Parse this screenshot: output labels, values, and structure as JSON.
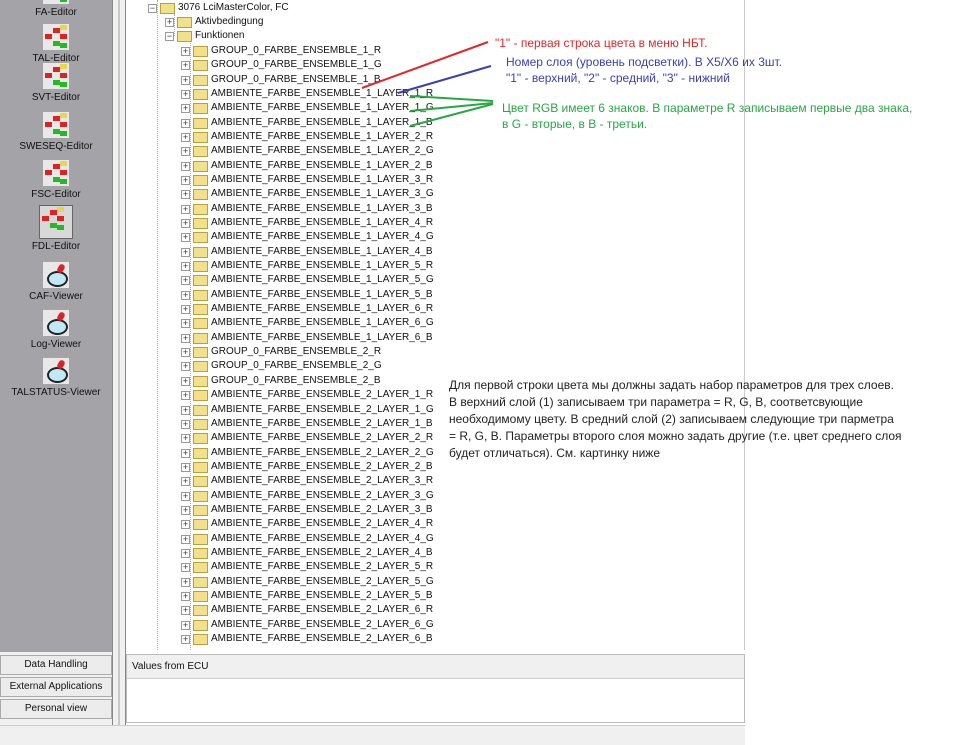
{
  "sidebar": {
    "tools": [
      "FA-Editor",
      "TAL-Editor",
      "SVT-Editor",
      "SWESEQ-Editor",
      "FSC-Editor",
      "FDL-Editor",
      "CAF-Viewer",
      "Log-Viewer",
      "TALSTATUS-Viewer"
    ],
    "selected": "FDL-Editor",
    "nav": [
      "Data Handling",
      "External Applications",
      "Personal view"
    ]
  },
  "tree": {
    "root": "3076 LciMasterColor, FC",
    "children": [
      "Aktivbedingung",
      "Funktionen"
    ],
    "functions": [
      "GROUP_0_FARBE_ENSEMBLE_1_R",
      "GROUP_0_FARBE_ENSEMBLE_1_G",
      "GROUP_0_FARBE_ENSEMBLE_1_B",
      "AMBIENTE_FARBE_ENSEMBLE_1_LAYER_1_R",
      "AMBIENTE_FARBE_ENSEMBLE_1_LAYER_1_G",
      "AMBIENTE_FARBE_ENSEMBLE_1_LAYER_1_B",
      "AMBIENTE_FARBE_ENSEMBLE_1_LAYER_2_R",
      "AMBIENTE_FARBE_ENSEMBLE_1_LAYER_2_G",
      "AMBIENTE_FARBE_ENSEMBLE_1_LAYER_2_B",
      "AMBIENTE_FARBE_ENSEMBLE_1_LAYER_3_R",
      "AMBIENTE_FARBE_ENSEMBLE_1_LAYER_3_G",
      "AMBIENTE_FARBE_ENSEMBLE_1_LAYER_3_B",
      "AMBIENTE_FARBE_ENSEMBLE_1_LAYER_4_R",
      "AMBIENTE_FARBE_ENSEMBLE_1_LAYER_4_G",
      "AMBIENTE_FARBE_ENSEMBLE_1_LAYER_4_B",
      "AMBIENTE_FARBE_ENSEMBLE_1_LAYER_5_R",
      "AMBIENTE_FARBE_ENSEMBLE_1_LAYER_5_G",
      "AMBIENTE_FARBE_ENSEMBLE_1_LAYER_5_B",
      "AMBIENTE_FARBE_ENSEMBLE_1_LAYER_6_R",
      "AMBIENTE_FARBE_ENSEMBLE_1_LAYER_6_G",
      "AMBIENTE_FARBE_ENSEMBLE_1_LAYER_6_B",
      "GROUP_0_FARBE_ENSEMBLE_2_R",
      "GROUP_0_FARBE_ENSEMBLE_2_G",
      "GROUP_0_FARBE_ENSEMBLE_2_B",
      "AMBIENTE_FARBE_ENSEMBLE_2_LAYER_1_R",
      "AMBIENTE_FARBE_ENSEMBLE_2_LAYER_1_G",
      "AMBIENTE_FARBE_ENSEMBLE_2_LAYER_1_B",
      "AMBIENTE_FARBE_ENSEMBLE_2_LAYER_2_R",
      "AMBIENTE_FARBE_ENSEMBLE_2_LAYER_2_G",
      "AMBIENTE_FARBE_ENSEMBLE_2_LAYER_2_B",
      "AMBIENTE_FARBE_ENSEMBLE_2_LAYER_3_R",
      "AMBIENTE_FARBE_ENSEMBLE_2_LAYER_3_G",
      "AMBIENTE_FARBE_ENSEMBLE_2_LAYER_3_B",
      "AMBIENTE_FARBE_ENSEMBLE_2_LAYER_4_R",
      "AMBIENTE_FARBE_ENSEMBLE_2_LAYER_4_G",
      "AMBIENTE_FARBE_ENSEMBLE_2_LAYER_4_B",
      "AMBIENTE_FARBE_ENSEMBLE_2_LAYER_5_R",
      "AMBIENTE_FARBE_ENSEMBLE_2_LAYER_5_G",
      "AMBIENTE_FARBE_ENSEMBLE_2_LAYER_5_B",
      "AMBIENTE_FARBE_ENSEMBLE_2_LAYER_6_R",
      "AMBIENTE_FARBE_ENSEMBLE_2_LAYER_6_G",
      "AMBIENTE_FARBE_ENSEMBLE_2_LAYER_6_B"
    ]
  },
  "ecu_panel": {
    "title": "Values from ECU"
  },
  "annotations": {
    "red": {
      "text": "\"1\" - первая строка цвета в меню НБТ.",
      "color": "#e0262c"
    },
    "blue": {
      "lines": [
        "Номер слоя (уровень подсветки). В X5/X6 их 3шт.",
        "\"1\" - верхний, \"2\" - средний, \"3\" - нижний"
      ],
      "color": "#3b3fb0"
    },
    "green": {
      "lines": [
        "Цвет RGB имеет 6 знаков. В параметре R записываем первые два знака,",
        "в G - вторые, в B - третьи."
      ],
      "color": "#27a844"
    },
    "black": {
      "lines": [
        "Для первой строки цвета мы должны задать набор параметров для трех слоев.",
        "В верхний слой (1) записываем три параметра = R, G, B, соответсвующие",
        "необходимому цвету. В средний слой (2) записываем следующие три парметра",
        "= R, G, B. Параметры второго слоя можно задать другие (т.е. цвет среднего слоя",
        "будет отличаться). См. картинку ниже"
      ],
      "color": "#222222"
    }
  }
}
